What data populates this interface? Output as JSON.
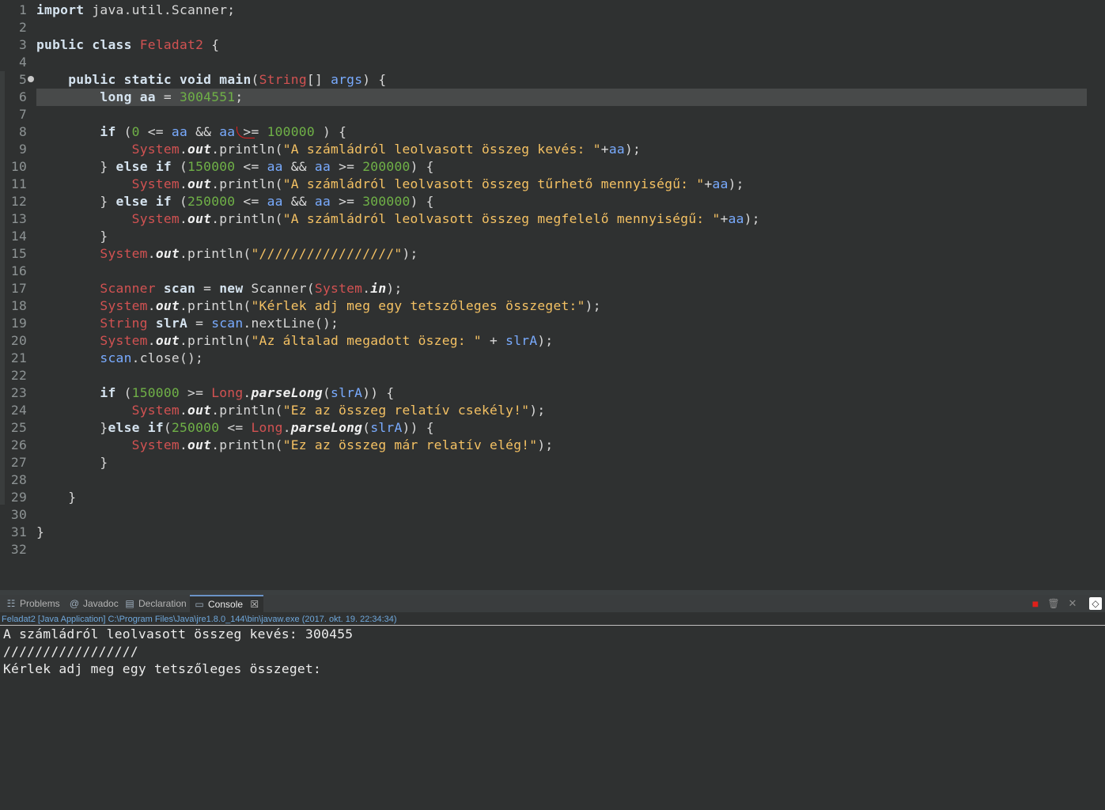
{
  "editor": {
    "lines": [
      {
        "n": "1",
        "tokens": [
          [
            "k",
            "import"
          ],
          [
            "o",
            " java.util.Scanner;"
          ]
        ]
      },
      {
        "n": "2",
        "tokens": []
      },
      {
        "n": "3",
        "tokens": [
          [
            "k",
            "public"
          ],
          [
            "o",
            " "
          ],
          [
            "k",
            "class"
          ],
          [
            "o",
            " "
          ],
          [
            "cls",
            "Feladat2"
          ],
          [
            "o",
            " {"
          ]
        ]
      },
      {
        "n": "4",
        "tokens": []
      },
      {
        "n": "5",
        "fold": true,
        "tokens": [
          [
            "o",
            "    "
          ],
          [
            "k",
            "public"
          ],
          [
            "o",
            " "
          ],
          [
            "k",
            "static"
          ],
          [
            "o",
            " "
          ],
          [
            "k",
            "void"
          ],
          [
            "o",
            " "
          ],
          [
            "k",
            "main"
          ],
          [
            "o",
            "("
          ],
          [
            "cls",
            "String"
          ],
          [
            "o",
            "[] "
          ],
          [
            "v",
            "args"
          ],
          [
            "o",
            ") {"
          ]
        ]
      },
      {
        "n": "6",
        "highlight": true,
        "tokens": [
          [
            "o",
            "        "
          ],
          [
            "k",
            "long"
          ],
          [
            "o",
            " "
          ],
          [
            "k",
            "aa"
          ],
          [
            "o",
            " = "
          ],
          [
            "n",
            "3004551"
          ],
          [
            "o",
            ";"
          ]
        ]
      },
      {
        "n": "7",
        "tokens": []
      },
      {
        "n": "8",
        "tokens": [
          [
            "o",
            "        "
          ],
          [
            "k",
            "if"
          ],
          [
            "o",
            " ("
          ],
          [
            "n",
            "0"
          ],
          [
            "o",
            " <= "
          ],
          [
            "v",
            "aa"
          ],
          [
            "o",
            " && "
          ],
          [
            "v",
            "aa"
          ],
          [
            "o",
            " >= "
          ],
          [
            "n",
            "100000"
          ],
          [
            "o",
            " ) {"
          ]
        ]
      },
      {
        "n": "9",
        "tokens": [
          [
            "o",
            "            "
          ],
          [
            "sys",
            "System"
          ],
          [
            "o",
            "."
          ],
          [
            "it",
            "out"
          ],
          [
            "o",
            ".println("
          ],
          [
            "s",
            "\"A számládról leolvasott összeg kevés: \""
          ],
          [
            "o",
            "+"
          ],
          [
            "v",
            "aa"
          ],
          [
            "o",
            ");"
          ]
        ]
      },
      {
        "n": "10",
        "tokens": [
          [
            "o",
            "        } "
          ],
          [
            "k",
            "else"
          ],
          [
            "o",
            " "
          ],
          [
            "k",
            "if"
          ],
          [
            "o",
            " ("
          ],
          [
            "n",
            "150000"
          ],
          [
            "o",
            " <= "
          ],
          [
            "v",
            "aa"
          ],
          [
            "o",
            " && "
          ],
          [
            "v",
            "aa"
          ],
          [
            "o",
            " >= "
          ],
          [
            "n",
            "200000"
          ],
          [
            "o",
            ") {"
          ]
        ]
      },
      {
        "n": "11",
        "tokens": [
          [
            "o",
            "            "
          ],
          [
            "sys",
            "System"
          ],
          [
            "o",
            "."
          ],
          [
            "it",
            "out"
          ],
          [
            "o",
            ".println("
          ],
          [
            "s",
            "\"A számládról leolvasott összeg tűrhető mennyiségű: \""
          ],
          [
            "o",
            "+"
          ],
          [
            "v",
            "aa"
          ],
          [
            "o",
            ");"
          ]
        ]
      },
      {
        "n": "12",
        "tokens": [
          [
            "o",
            "        } "
          ],
          [
            "k",
            "else"
          ],
          [
            "o",
            " "
          ],
          [
            "k",
            "if"
          ],
          [
            "o",
            " ("
          ],
          [
            "n",
            "250000"
          ],
          [
            "o",
            " <= "
          ],
          [
            "v",
            "aa"
          ],
          [
            "o",
            " && "
          ],
          [
            "v",
            "aa"
          ],
          [
            "o",
            " >= "
          ],
          [
            "n",
            "300000"
          ],
          [
            "o",
            ") {"
          ]
        ]
      },
      {
        "n": "13",
        "tokens": [
          [
            "o",
            "            "
          ],
          [
            "sys",
            "System"
          ],
          [
            "o",
            "."
          ],
          [
            "it",
            "out"
          ],
          [
            "o",
            ".println("
          ],
          [
            "s",
            "\"A számládról leolvasott összeg megfelelő mennyiségű: \""
          ],
          [
            "o",
            "+"
          ],
          [
            "v",
            "aa"
          ],
          [
            "o",
            ");"
          ]
        ]
      },
      {
        "n": "14",
        "tokens": [
          [
            "o",
            "        }"
          ]
        ]
      },
      {
        "n": "15",
        "tokens": [
          [
            "o",
            "        "
          ],
          [
            "sys",
            "System"
          ],
          [
            "o",
            "."
          ],
          [
            "it",
            "out"
          ],
          [
            "o",
            ".println("
          ],
          [
            "s",
            "\"/////////////////\""
          ],
          [
            "o",
            ");"
          ]
        ]
      },
      {
        "n": "16",
        "tokens": []
      },
      {
        "n": "17",
        "tokens": [
          [
            "o",
            "        "
          ],
          [
            "cls",
            "Scanner"
          ],
          [
            "o",
            " "
          ],
          [
            "k",
            "scan"
          ],
          [
            "o",
            " = "
          ],
          [
            "k",
            "new"
          ],
          [
            "o",
            " Scanner("
          ],
          [
            "sys",
            "System"
          ],
          [
            "o",
            "."
          ],
          [
            "it",
            "in"
          ],
          [
            "o",
            ");"
          ]
        ]
      },
      {
        "n": "18",
        "tokens": [
          [
            "o",
            "        "
          ],
          [
            "sys",
            "System"
          ],
          [
            "o",
            "."
          ],
          [
            "it",
            "out"
          ],
          [
            "o",
            ".println("
          ],
          [
            "s",
            "\"Kérlek adj meg egy tetszőleges összeget:\""
          ],
          [
            "o",
            ");"
          ]
        ]
      },
      {
        "n": "19",
        "tokens": [
          [
            "o",
            "        "
          ],
          [
            "cls",
            "String"
          ],
          [
            "o",
            " "
          ],
          [
            "k",
            "slrA"
          ],
          [
            "o",
            " = "
          ],
          [
            "v",
            "scan"
          ],
          [
            "o",
            ".nextLine();"
          ]
        ]
      },
      {
        "n": "20",
        "tokens": [
          [
            "o",
            "        "
          ],
          [
            "sys",
            "System"
          ],
          [
            "o",
            "."
          ],
          [
            "it",
            "out"
          ],
          [
            "o",
            ".println("
          ],
          [
            "s",
            "\"Az általad megadott öszeg: \""
          ],
          [
            "o",
            " + "
          ],
          [
            "v",
            "slrA"
          ],
          [
            "o",
            ");"
          ]
        ]
      },
      {
        "n": "21",
        "tokens": [
          [
            "o",
            "        "
          ],
          [
            "v",
            "scan"
          ],
          [
            "o",
            ".close();"
          ]
        ]
      },
      {
        "n": "22",
        "tokens": []
      },
      {
        "n": "23",
        "tokens": [
          [
            "o",
            "        "
          ],
          [
            "k",
            "if"
          ],
          [
            "o",
            " ("
          ],
          [
            "n",
            "150000"
          ],
          [
            "o",
            " >= "
          ],
          [
            "cls",
            "Long"
          ],
          [
            "o",
            "."
          ],
          [
            "it",
            "parseLong"
          ],
          [
            "o",
            "("
          ],
          [
            "v",
            "slrA"
          ],
          [
            "o",
            ")) {"
          ]
        ]
      },
      {
        "n": "24",
        "tokens": [
          [
            "o",
            "            "
          ],
          [
            "sys",
            "System"
          ],
          [
            "o",
            "."
          ],
          [
            "it",
            "out"
          ],
          [
            "o",
            ".println("
          ],
          [
            "s",
            "\"Ez az összeg relatív csekély!\""
          ],
          [
            "o",
            ");"
          ]
        ]
      },
      {
        "n": "25",
        "tokens": [
          [
            "o",
            "        }"
          ],
          [
            "k",
            "else"
          ],
          [
            "o",
            " "
          ],
          [
            "k",
            "if"
          ],
          [
            "o",
            "("
          ],
          [
            "n",
            "250000"
          ],
          [
            "o",
            " <= "
          ],
          [
            "cls",
            "Long"
          ],
          [
            "o",
            "."
          ],
          [
            "it",
            "parseLong"
          ],
          [
            "o",
            "("
          ],
          [
            "v",
            "slrA"
          ],
          [
            "o",
            ")) {"
          ]
        ]
      },
      {
        "n": "26",
        "tokens": [
          [
            "o",
            "            "
          ],
          [
            "sys",
            "System"
          ],
          [
            "o",
            "."
          ],
          [
            "it",
            "out"
          ],
          [
            "o",
            ".println("
          ],
          [
            "s",
            "\"Ez az összeg már relatív elég!\""
          ],
          [
            "o",
            ");"
          ]
        ]
      },
      {
        "n": "27",
        "tokens": [
          [
            "o",
            "        }"
          ]
        ]
      },
      {
        "n": "28",
        "tokens": []
      },
      {
        "n": "29",
        "tokens": [
          [
            "o",
            "    }"
          ]
        ]
      },
      {
        "n": "30",
        "tokens": []
      },
      {
        "n": "31",
        "tokens": [
          [
            "o",
            "}"
          ]
        ]
      },
      {
        "n": "32",
        "tokens": []
      }
    ]
  },
  "panel": {
    "tabs": [
      {
        "label": "Problems",
        "icon": "problems-icon",
        "glyph": "☷"
      },
      {
        "label": "Javadoc",
        "icon": "javadoc-icon",
        "glyph": "@"
      },
      {
        "label": "Declaration",
        "icon": "declaration-icon",
        "glyph": "▤"
      },
      {
        "label": "Console",
        "icon": "console-icon",
        "glyph": "▭",
        "active": true,
        "close": "☒"
      }
    ],
    "launch_info": "Feladat2 [Java Application] C:\\Program Files\\Java\\jre1.8.0_144\\bin\\javaw.exe (2017. okt. 19. 22:34:34)",
    "console_lines": [
      "A számládról leolvasott összeg kevés: 300455",
      "/////////////////",
      "Kérlek adj meg egy tetszőleges összeget:"
    ],
    "toolbar": {
      "terminate": "■",
      "remove": "🗑",
      "remove_all": "✕",
      "clear": "◇"
    }
  },
  "colors": {
    "editor_bg": "#2f3131",
    "current_line": "#484a4a",
    "keyword": "#d5e3ef",
    "type": "#d25252",
    "string": "#f4c163",
    "number": "#6fb047",
    "variable": "#79abff",
    "terminate_red": "#e0201a"
  }
}
